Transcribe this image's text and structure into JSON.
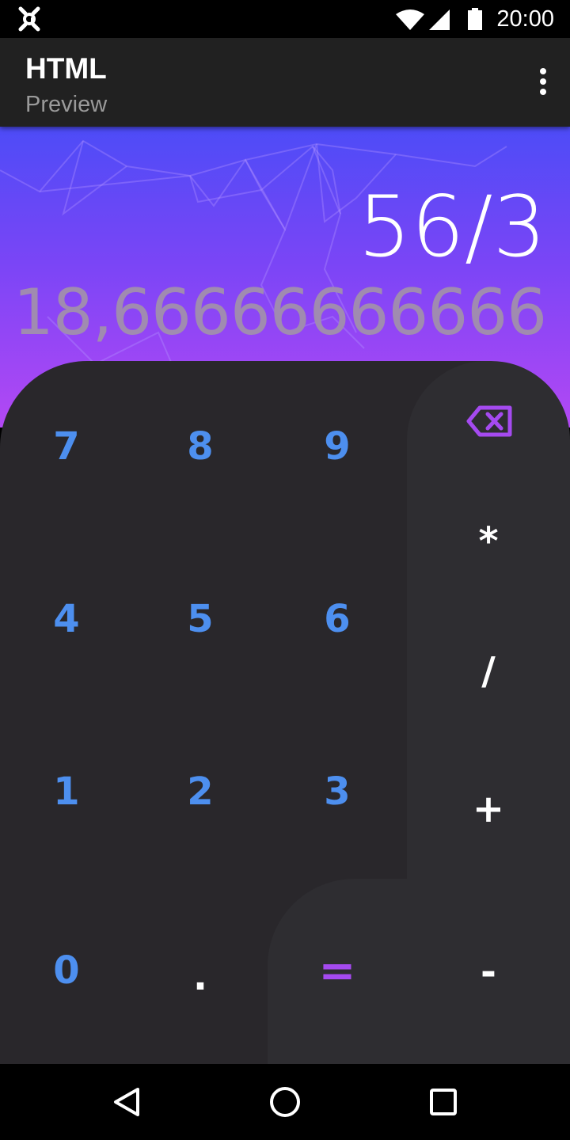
{
  "status_bar": {
    "time": "20:00",
    "icons": [
      "app-notification-icon",
      "wifi-icon",
      "cell-signal-icon",
      "battery-icon"
    ]
  },
  "app_bar": {
    "title": "HTML",
    "subtitle": "Preview",
    "menu_icon": "more-vert-icon"
  },
  "display": {
    "expression": "56/3",
    "result": "18,66666666666"
  },
  "keypad": {
    "digits": {
      "d7": "7",
      "d8": "8",
      "d9": "9",
      "d4": "4",
      "d5": "5",
      "d6": "6",
      "d1": "1",
      "d2": "2",
      "d3": "3",
      "d0": "0",
      "dot": "."
    },
    "operators": {
      "multiply": "*",
      "divide": "/",
      "plus": "+",
      "minus": "-",
      "equals": "="
    },
    "backspace_icon": "backspace-icon"
  },
  "nav_bar": {
    "icons": [
      "back-icon",
      "home-icon",
      "recents-icon"
    ]
  },
  "colors": {
    "digit": "#4d8fef",
    "accent": "#a54af0",
    "gradient_top": "#4d4cf7",
    "gradient_bottom": "#b348f4",
    "keypad_bg": "#29272b",
    "ops_bg": "#2e2d31"
  }
}
